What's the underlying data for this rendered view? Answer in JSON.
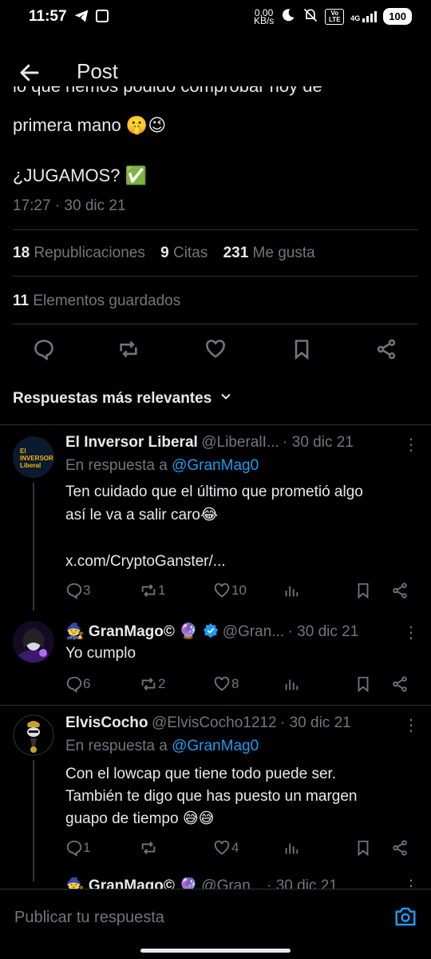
{
  "status_bar": {
    "time": "11:57",
    "net_speed_value": "0,00",
    "net_speed_unit": "KB/s",
    "network": "4G",
    "volte": "Vo LTE",
    "battery": "100"
  },
  "header": {
    "title": "Post"
  },
  "post": {
    "clipped_line": "lo que hemos podido comprobar hoy de",
    "line2": "primera mano 🤫😉",
    "line3": "¿JUGAMOS? ✅",
    "timestamp": "17:27 · 30 dic 21",
    "reposts_count": "18",
    "reposts_label": "Republicaciones",
    "quotes_count": "9",
    "quotes_label": "Citas",
    "likes_count": "231",
    "likes_label": "Me gusta",
    "saved_count": "11",
    "saved_label": "Elementos guardados"
  },
  "sort": {
    "label": "Respuestas más relevantes"
  },
  "replies": [
    {
      "name": "El Inversor Liberal",
      "handle": "@LiberalI...",
      "date": "· 30 dic 21",
      "reply_to_prefix": "En respuesta a",
      "reply_to": "@GranMag0",
      "text1": "Ten cuidado que el último que prometió algo",
      "text2": "así le va a salir caro😂",
      "link": "x.com/CryptoGanster/...",
      "replies": "3",
      "reposts": "1",
      "likes": "10",
      "avatar_text": "El INVERSOR Liberal"
    },
    {
      "name": "🧙 GranMago© 🔮",
      "handle": "@Gran...",
      "date": "· 30 dic 21",
      "text1": "Yo cumplo",
      "replies": "6",
      "reposts": "2",
      "likes": "8"
    },
    {
      "name": "ElvisCocho",
      "handle": "@ElvisCocho1212",
      "date": "· 30 dic 21",
      "reply_to_prefix": "En respuesta a",
      "reply_to": "@GranMag0",
      "text1": "Con el lowcap que tiene todo puede ser.",
      "text2": "También te digo que has puesto un margen",
      "text3": "guapo de tiempo 😅😅",
      "replies": "1",
      "reposts": "",
      "likes": "4"
    },
    {
      "name": "🧙 GranMago© 🔮",
      "handle": "@Gran...",
      "date": "· 30 dic 21"
    }
  ],
  "composer": {
    "placeholder": "Publicar tu respuesta"
  },
  "colors": {
    "accent": "#1d9bf0",
    "muted": "#71767b",
    "text": "#e7e9ea",
    "divider": "#2f3336"
  }
}
